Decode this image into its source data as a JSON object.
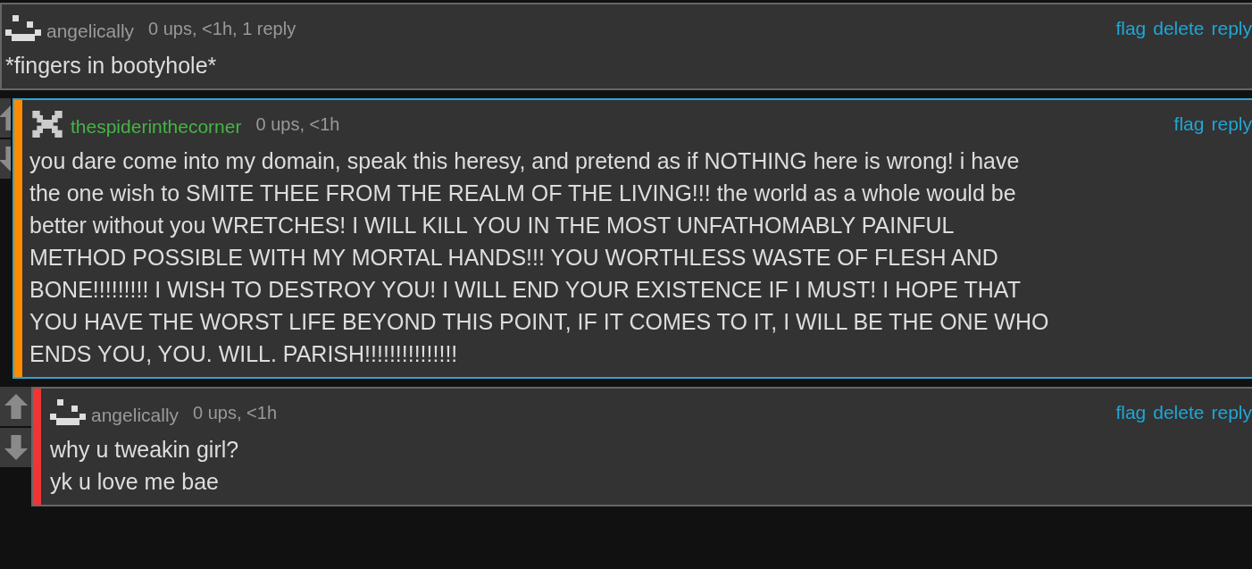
{
  "comments": [
    {
      "kind": "top",
      "author": "angelically",
      "avatar": {
        "kind": "smile"
      },
      "color": "#9a9a9a",
      "meta": "0 ups, <1h, 1 reply",
      "actions": [
        "flag",
        "delete",
        "reply"
      ],
      "lines": [
        "*fingers in bootyhole*"
      ]
    },
    {
      "kind": "highlighted",
      "author": "thespiderinthecorner",
      "avatar": {
        "kind": "cross"
      },
      "color": "#46b446",
      "meta": "0 ups, <1h",
      "actions": [
        "flag",
        "reply"
      ],
      "lines": [
        "you dare come into my domain, speak this heresy, and pretend as if NOTHING here is wrong! i have",
        "the one wish to SMITE THEE FROM THE REALM OF THE LIVING!!! the world as a whole would be",
        "better without you WRETCHES! I WILL KILL YOU IN THE MOST UNFATHOMABLY PAINFUL",
        "METHOD POSSIBLE WITH MY MORTAL HANDS!!! YOU WORTHLESS WASTE OF FLESH AND",
        "BONE!!!!!!!!! I WISH TO DESTROY YOU! I WILL END YOUR EXISTENCE IF I MUST! I HOPE THAT",
        "YOU HAVE THE WORST LIFE BEYOND THIS POINT, IF IT COMES TO IT, I WILL BE THE ONE WHO",
        "ENDS YOU, YOU. WILL. PARISH!!!!!!!!!!!!!!!"
      ]
    },
    {
      "kind": "reply",
      "author": "angelically",
      "avatar": {
        "kind": "smile"
      },
      "color": "#9a9a9a",
      "meta": "0 ups, <1h",
      "actions": [
        "flag",
        "delete",
        "reply"
      ],
      "lines": [
        "why u tweakin girl?",
        "yk u love me bae"
      ]
    }
  ]
}
